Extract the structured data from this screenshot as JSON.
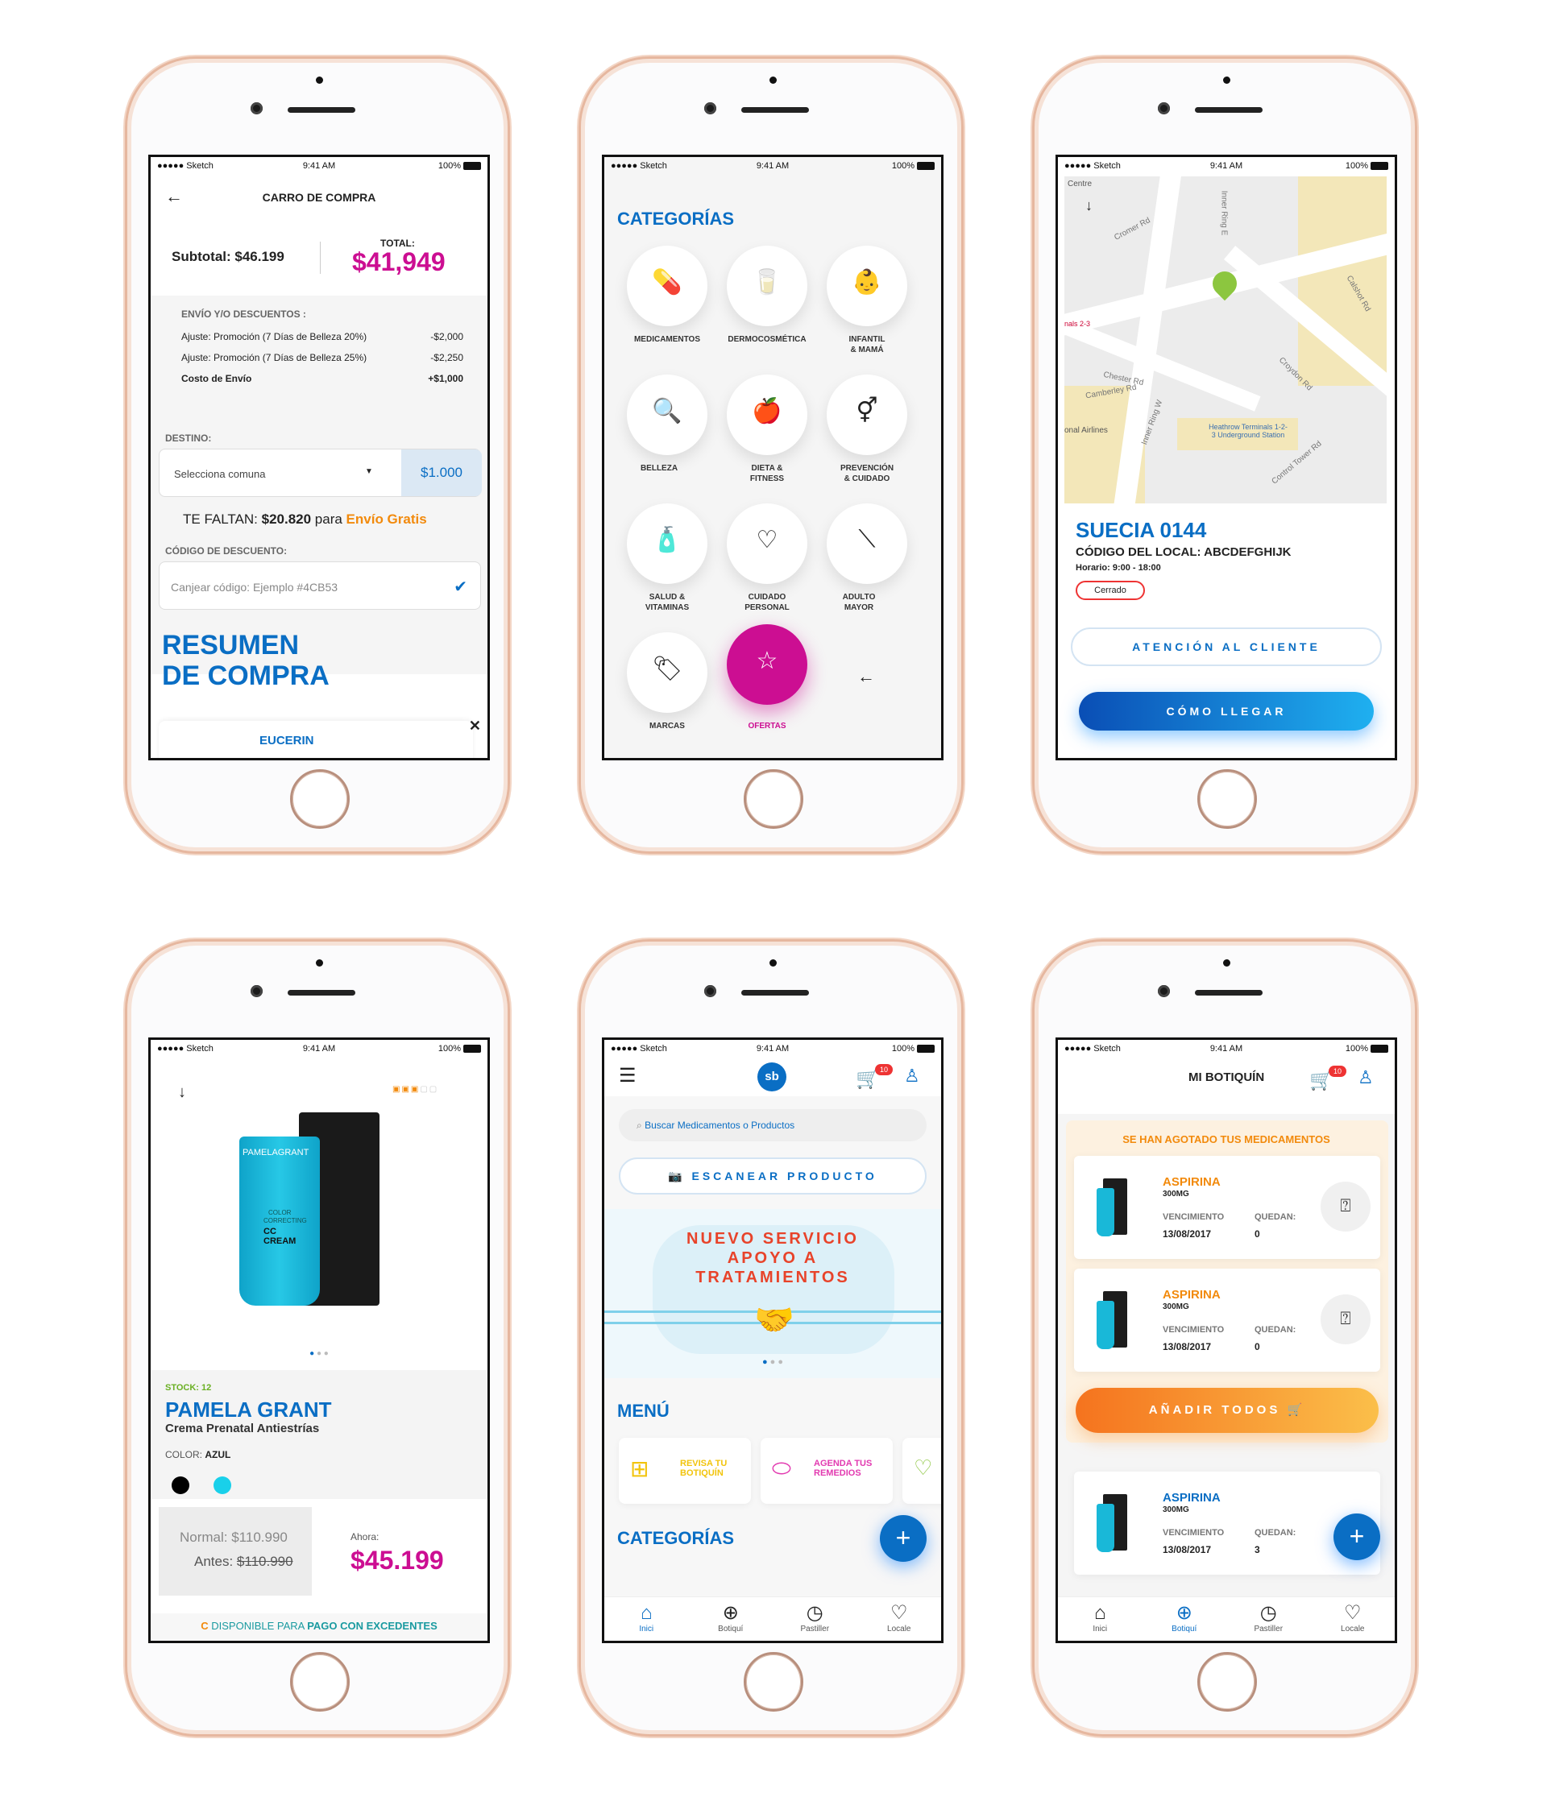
{
  "status": {
    "carrier": "●●●●● Sketch",
    "time": "9:41 AM",
    "battery": "100%"
  },
  "cart": {
    "title": "CARRO DE COMPRA",
    "subtotal": "Subtotal: $46.199",
    "total_label": "TOTAL:",
    "total_value": "$41,949",
    "envio_title": "ENVÍO Y/O DESCUENTOS :",
    "adjustments": [
      {
        "label": "Ajuste: Promoción (7 Días de Belleza 20%)",
        "value": "-$2,000"
      },
      {
        "label": "Ajuste: Promoción (7 Días de Belleza 25%)",
        "value": "-$2,250"
      },
      {
        "label": "Costo de Envío",
        "value": "+$1,000"
      }
    ],
    "destino_label": "DESTINO:",
    "comuna_placeholder": "Selecciona comuna",
    "comuna_price": "$1.000",
    "faltan_prefix": "TE FALTAN: ",
    "faltan_amount": "$20.820",
    "faltan_mid": " para ",
    "envio_gratis": "Envío Gratis",
    "codigo_label": "CÓDIGO DE DESCUENTO:",
    "codigo_placeholder": "Canjear código: Ejemplo #4CB53",
    "resumen_line1": "RESUMEN",
    "resumen_line2": "DE COMPRA",
    "product_brand": "EUCERIN",
    "close_glyph": "✕"
  },
  "categories": {
    "title": "CATEGORÍAS",
    "items": [
      {
        "label": "MEDICAMENTOS",
        "icon": "💊"
      },
      {
        "label": "DERMOCOSMÉTICA",
        "icon": "🥛"
      },
      {
        "label": "INFANTIL & MAMÁ",
        "icon": "👶"
      },
      {
        "label": "BELLEZA",
        "icon": "🔍"
      },
      {
        "label": "DIETA & FITNESS",
        "icon": "🍎"
      },
      {
        "label": "PREVENCIÓN & CUIDADO",
        "icon": "⚥"
      },
      {
        "label": "SALUD & VITAMINAS",
        "icon": "🧴"
      },
      {
        "label": "CUIDADO PERSONAL",
        "icon": "♡"
      },
      {
        "label": "ADULTO MAYOR",
        "icon": "⟍"
      },
      {
        "label": "MARCAS",
        "icon": "🏷"
      },
      {
        "label": "OFERTAS",
        "icon": "☆"
      }
    ],
    "back_glyph": "←"
  },
  "store": {
    "map_labels": [
      "Centre",
      "Cromer Rd",
      "Inner Ring E",
      "Chester Rd",
      "Camberley Rd",
      "Inner Ring W",
      "Heathrow Terminals 1-2-3 Underground Station",
      "Control Tower Rd",
      "Croydon Rd",
      "Calshot Rd",
      "nals 2-3",
      "onal Airlines"
    ],
    "name": "SUECIA 0144",
    "code": "CÓDIGO DEL LOCAL: ABCDEFGHIJK",
    "hours": "Horario: 9:00 - 18:00",
    "status": "Cerrado",
    "support_btn": "ATENCIÓN AL CLIENTE",
    "directions_btn": "CÓMO LLEGAR"
  },
  "product": {
    "stock": "STOCK: 12",
    "brand": "PAMELA GRANT",
    "name": "Crema Prenatal Antiestrías",
    "color_label": "COLOR:",
    "color_value": "AZUL",
    "tube_brand": "PAMELAGRANT",
    "tube_text1": "COLOR",
    "tube_text2": "CORRECTING",
    "tube_text3": "CC CREAM",
    "normal_price": "Normal: $110.990",
    "antes_label": "Antes: ",
    "antes_price": "$110.990",
    "ahora_label": "Ahora:",
    "ahora_price": "$45.199",
    "pago_disponible": "DISPONIBLE PARA ",
    "pago_excedentes": "PAGO CON EXCEDENTES",
    "swatches": [
      "#000000",
      "#19d0ea"
    ]
  },
  "home": {
    "logo": "sb",
    "cart_count": "10",
    "search_placeholder": "Buscar Medicamentos o Productos",
    "scan_btn": "ESCANEAR PRODUCTO",
    "banner_line1": "NUEVO SERVICIO",
    "banner_line2": "APOYO A",
    "banner_line3": "TRATAMIENTOS",
    "menu_title": "MENÚ",
    "menu_items": [
      {
        "label": "REVISA TU BOTIQUÍN",
        "color": "#f2c40c"
      },
      {
        "label": "AGENDA TUS REMEDIOS",
        "color": "#e23ab0"
      }
    ],
    "categorias_title": "CATEGORÍAS",
    "fab": "+"
  },
  "botiquin": {
    "title": "MI BOTIQUÍN",
    "cart_count": "10",
    "agotado_title": "SE HAN AGOTADO TUS MEDICAMENTOS",
    "meds": [
      {
        "name": "ASPIRINA",
        "dose": "300MG",
        "venc_label": "VENCIMIENTO",
        "venc": "13/08/2017",
        "quedan_label": "QUEDAN:",
        "quedan": "0"
      },
      {
        "name": "ASPIRINA",
        "dose": "300MG",
        "venc_label": "VENCIMIENTO",
        "venc": "13/08/2017",
        "quedan_label": "QUEDAN:",
        "quedan": "0"
      },
      {
        "name": "ASPIRINA",
        "dose": "300MG",
        "venc_label": "VENCIMIENTO",
        "venc": "13/08/2017",
        "quedan_label": "QUEDAN:",
        "quedan": "3"
      }
    ],
    "add_all_btn": "AÑADIR TODOS",
    "fab": "+"
  },
  "tabs": [
    {
      "label": "Inici",
      "icon": "⌂"
    },
    {
      "label": "Botiquí",
      "icon": "⊕"
    },
    {
      "label": "Pastiller",
      "icon": "◷"
    },
    {
      "label": "Locale",
      "icon": "♡"
    }
  ]
}
